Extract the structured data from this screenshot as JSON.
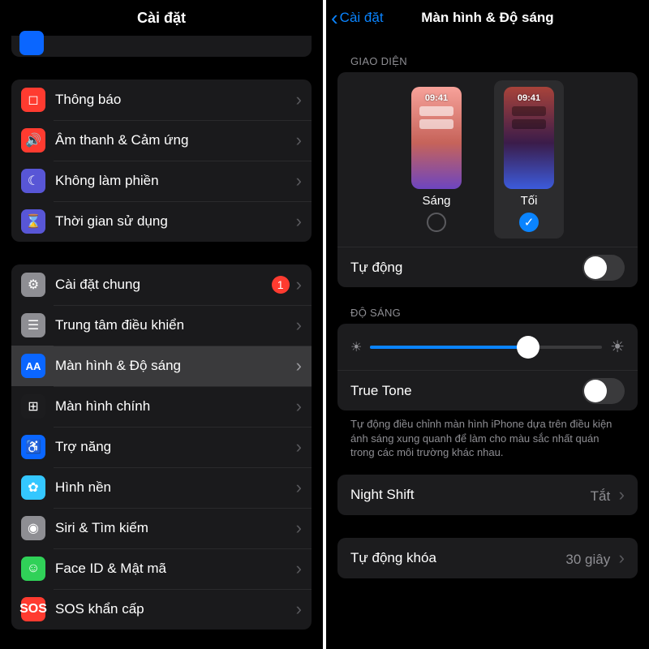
{
  "left": {
    "title": "Cài đặt",
    "groups": [
      [
        {
          "key": "thong-bao",
          "label": "Thông báo",
          "iconClass": "ic-red",
          "glyph": "◻"
        },
        {
          "key": "am-thanh",
          "label": "Âm thanh & Cảm ứng",
          "iconClass": "ic-red",
          "glyph": "🔊"
        },
        {
          "key": "khong-lam-phien",
          "label": "Không làm phiền",
          "iconClass": "ic-purple",
          "glyph": "☾"
        },
        {
          "key": "thoi-gian",
          "label": "Thời gian sử dụng",
          "iconClass": "ic-purple",
          "glyph": "⌛"
        }
      ],
      [
        {
          "key": "cai-dat-chung",
          "label": "Cài đặt chung",
          "iconClass": "ic-gray",
          "glyph": "⚙",
          "badge": "1"
        },
        {
          "key": "trung-tam",
          "label": "Trung tâm điều khiển",
          "iconClass": "ic-gray",
          "glyph": "☰"
        },
        {
          "key": "man-hinh-do-sang",
          "label": "Màn hình & Độ sáng",
          "iconClass": "ic-blue",
          "glyph": "AA",
          "selected": true
        },
        {
          "key": "man-hinh-chinh",
          "label": "Màn hình chính",
          "iconClass": "ic-homescreen",
          "glyph": "⊞"
        },
        {
          "key": "tro-nang",
          "label": "Trợ năng",
          "iconClass": "ic-blue",
          "glyph": "♿"
        },
        {
          "key": "hinh-nen",
          "label": "Hình nền",
          "iconClass": "ic-cyan",
          "glyph": "✿"
        },
        {
          "key": "siri",
          "label": "Siri & Tìm kiếm",
          "iconClass": "ic-gray",
          "glyph": "◉"
        },
        {
          "key": "face-id",
          "label": "Face ID & Mật mã",
          "iconClass": "ic-green",
          "glyph": "☺"
        },
        {
          "key": "sos",
          "label": "SOS khẩn cấp",
          "iconClass": "ic-sosred",
          "glyph": "SOS"
        }
      ]
    ]
  },
  "right": {
    "back": "Cài đặt",
    "title": "Màn hình & Độ sáng",
    "section_appearance": "GIAO DIỆN",
    "preview_time": "09:41",
    "light_label": "Sáng",
    "dark_label": "Tối",
    "selected_mode": "dark",
    "automatic_label": "Tự động",
    "automatic_on": false,
    "section_brightness": "ĐỘ SÁNG",
    "brightness_percent": 68,
    "truetone_label": "True Tone",
    "truetone_on": false,
    "truetone_note": "Tự động điều chỉnh màn hình iPhone dựa trên điều kiện ánh sáng xung quanh để làm cho màu sắc nhất quán trong các môi trường khác nhau.",
    "nightshift_label": "Night Shift",
    "nightshift_value": "Tắt",
    "autolock_label": "Tự động khóa",
    "autolock_value": "30 giây"
  }
}
